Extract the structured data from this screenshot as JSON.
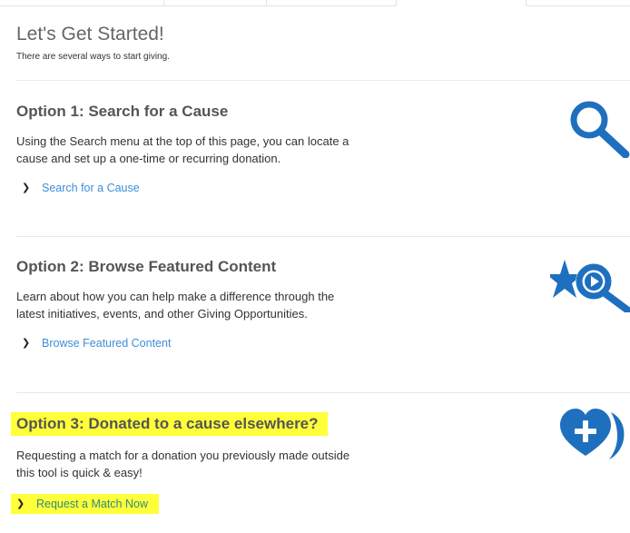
{
  "header": {
    "title": "Let's Get Started!",
    "subtitle": "There are several ways to start giving."
  },
  "options": [
    {
      "heading": "Option 1: Search for a Cause",
      "text": "Using the Search menu at the top of this page, you can locate a cause and set up a one-time or recurring donation.",
      "link_label": "Search for a Cause",
      "icon": "search-icon"
    },
    {
      "heading": "Option 2: Browse Featured Content",
      "text": "Learn about how you can help make a difference through the latest initiatives, events, and other Giving Opportunities.",
      "link_label": "Browse Featured Content",
      "icon": "featured-star-play-icon"
    },
    {
      "heading": "Option 3: Donated to a cause elsewhere?",
      "text": "Requesting a match for a donation you previously made outside this tool is quick & easy!",
      "link_label": "Request a Match Now",
      "icon": "heart-plus-icon"
    }
  ],
  "colors": {
    "accent": "#1e70bf",
    "link": "#3d8fd6",
    "highlight": "#ffff3a"
  }
}
